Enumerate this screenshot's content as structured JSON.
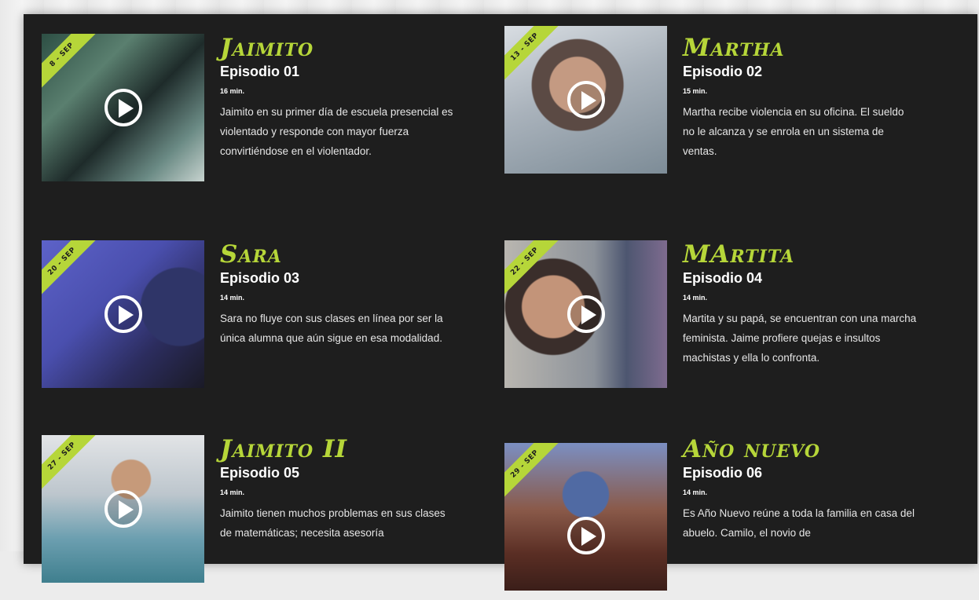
{
  "colors": {
    "accent": "#b6d639",
    "panel_bg": "#1e1e1e",
    "text": "#ffffff"
  },
  "episodes": [
    {
      "character": "Jaimito",
      "episode": "Episodio 01",
      "date": "8 - SEP",
      "duration": "16 min.",
      "description": "Jaimito en su primer día de escuela presencial es violentado y responde con mayor fuerza convirtiéndose en el violentador.",
      "play_icon": "play-icon"
    },
    {
      "character": "Martha",
      "episode": "Episodio 02",
      "date": "13 - SEP",
      "duration": "15 min.",
      "description": "Martha recibe violencia en su oficina. El sueldo no le alcanza y se enrola en un sistema de ventas.",
      "play_icon": "play-icon"
    },
    {
      "character": "Sara",
      "episode": "Episodio 03",
      "date": "20 - SEP",
      "duration": "14 min.",
      "description": "Sara no fluye con sus clases en línea por ser la única alumna que aún sigue en esa modalidad.",
      "play_icon": "play-icon"
    },
    {
      "character": "MArtita",
      "episode": "Episodio 04",
      "date": "22 - SEP",
      "duration": "14 min.",
      "description": "Martita y su papá, se encuentran con una marcha feminista. Jaime profiere quejas e insultos machistas y ella lo confronta.",
      "play_icon": "play-icon"
    },
    {
      "character": "Jaimito II",
      "episode": "Episodio 05",
      "date": "27 - SEP",
      "duration": "14 min.",
      "description": "Jaimito tienen muchos problemas en sus clases de matemáticas; necesita asesoría",
      "play_icon": "play-icon"
    },
    {
      "character": "Año nuevo",
      "episode": "Episodio 06",
      "date": "29 - SEP",
      "duration": "14 min.",
      "description": "Es Año Nuevo reúne a toda la familia en casa del abuelo. Camilo, el novio de",
      "play_icon": "play-icon"
    }
  ]
}
